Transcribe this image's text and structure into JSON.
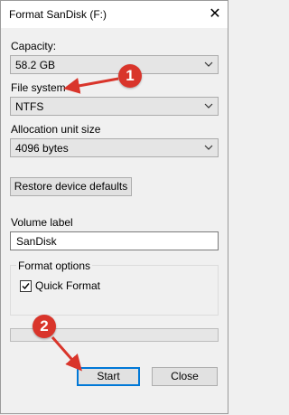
{
  "window": {
    "title": "Format SanDisk (F:)",
    "close_glyph": "✕"
  },
  "capacity": {
    "label": "Capacity:",
    "value": "58.2 GB"
  },
  "file_system": {
    "label": "File system",
    "value": "NTFS"
  },
  "allocation": {
    "label": "Allocation unit size",
    "value": "4096 bytes"
  },
  "restore_button": {
    "label": "Restore device defaults"
  },
  "volume": {
    "label": "Volume label",
    "value": "SanDisk"
  },
  "format_options": {
    "title": "Format options",
    "quick_format_label": "Quick Format",
    "quick_format_checked": true
  },
  "progress": {
    "fraction": 0
  },
  "buttons": {
    "start": "Start",
    "close": "Close"
  },
  "annotations": [
    {
      "number": "1",
      "target": "file-system-label"
    },
    {
      "number": "2",
      "target": "start-button"
    }
  ],
  "colors": {
    "annotation": "#d9352b",
    "accent": "#0078d7",
    "progress_fill": "#06b025"
  }
}
